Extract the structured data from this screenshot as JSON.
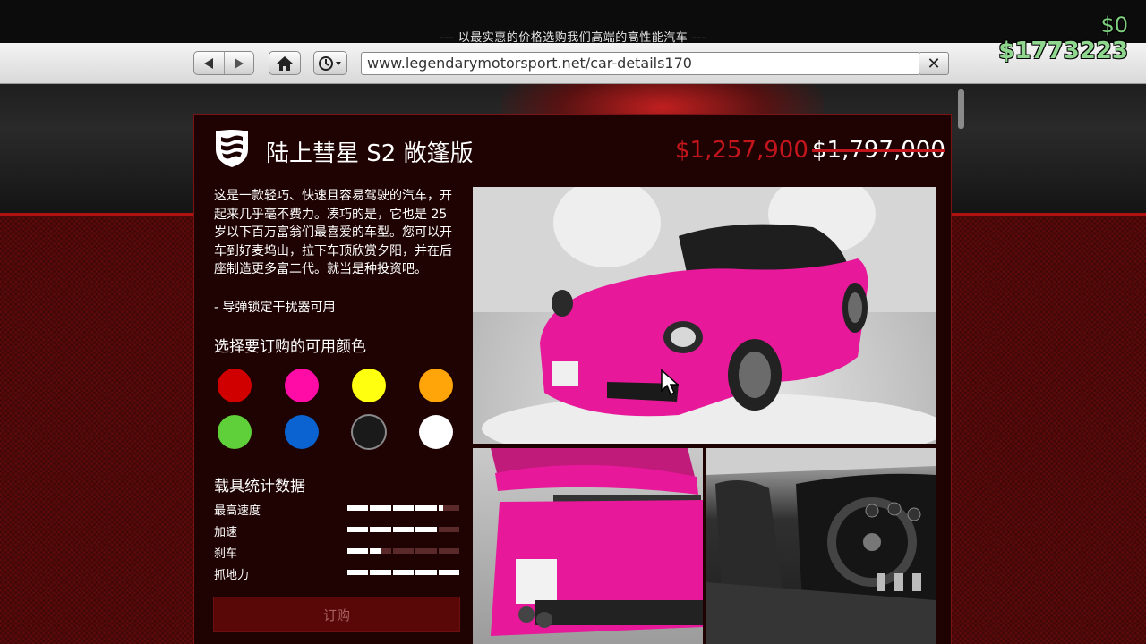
{
  "header": {
    "tagline": "--- 以最实惠的价格选购我们高端的高性能汽车 ---"
  },
  "browser": {
    "url": "www.legendarymotorsport.net/car-details170"
  },
  "hud": {
    "money_delta": "$0",
    "money_total": "$1773223"
  },
  "vehicle": {
    "title": "陆上彗星 S2 敞篷版",
    "price_sale": "$1,257,900",
    "price_original": "$1,797,000",
    "description": "这是一款轻巧、快速且容易驾驶的汽车，开起来几乎毫不费力。凑巧的是，它也是 25 岁以下百万富翁们最喜爱的车型。您可以开车到好麦坞山，拉下车顶欣赏夕阳，并在后座制造更多富二代。就当是种投资吧。",
    "feature": "- 导弹锁定干扰器可用"
  },
  "colors": {
    "heading": "选择要订购的可用颜色",
    "swatches": [
      {
        "name": "red",
        "hex": "#d10000"
      },
      {
        "name": "pink",
        "hex": "#ff0ca6"
      },
      {
        "name": "yellow",
        "hex": "#ffff10"
      },
      {
        "name": "orange",
        "hex": "#ffa509"
      },
      {
        "name": "green",
        "hex": "#5fcf3a"
      },
      {
        "name": "blue",
        "hex": "#0a63d0"
      },
      {
        "name": "black",
        "hex": "#1a1a1a"
      },
      {
        "name": "white",
        "hex": "#ffffff"
      }
    ]
  },
  "stats": {
    "heading": "载具统计数据",
    "items": [
      {
        "label": "最高速度",
        "value": 0.85
      },
      {
        "label": "加速",
        "value": 0.8
      },
      {
        "label": "刹车",
        "value": 0.3
      },
      {
        "label": "抓地力",
        "value": 1.0
      }
    ]
  },
  "actions": {
    "order_label": "订购"
  },
  "images": {
    "car_color": "#e8189a"
  }
}
